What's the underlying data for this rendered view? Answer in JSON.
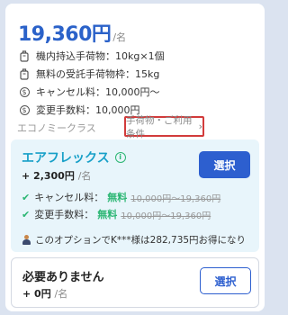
{
  "fare": {
    "price": "19,360円",
    "per": "/名"
  },
  "features": [
    {
      "icon": "luggage-icon",
      "text": "機内持込手荷物：10kg×1個"
    },
    {
      "icon": "luggage-icon",
      "text": "無料の受託手荷物枠：15kg"
    },
    {
      "icon": "dollar-circle-icon",
      "text": "キャンセル料：10,000円〜"
    },
    {
      "icon": "dollar-circle-icon",
      "text": "変更手数料：10,000円"
    }
  ],
  "fare_class": "エコノミークラス",
  "terms_link": "手荷物・ご利用条件",
  "options": [
    {
      "title": "エアフレックス",
      "price": "+ 2,300円",
      "per": "/名",
      "select_label": "選択",
      "benefits": [
        {
          "label": "キャンセル料：",
          "value": "無料",
          "old": "10,000円〜19,360円"
        },
        {
          "label": "変更手数料：",
          "value": "無料",
          "old": "10,000円〜19,360円"
        }
      ],
      "savings_note": "このオプションでK***様は282,735円お得になり"
    },
    {
      "title": "必要ありません",
      "price": "+ 0円",
      "per": "/名",
      "select_label": "選択"
    }
  ],
  "colors": {
    "accent": "#2b62c9",
    "flex": "#18a0c8",
    "free": "#2bb673",
    "highlight": "#d23b3b"
  }
}
